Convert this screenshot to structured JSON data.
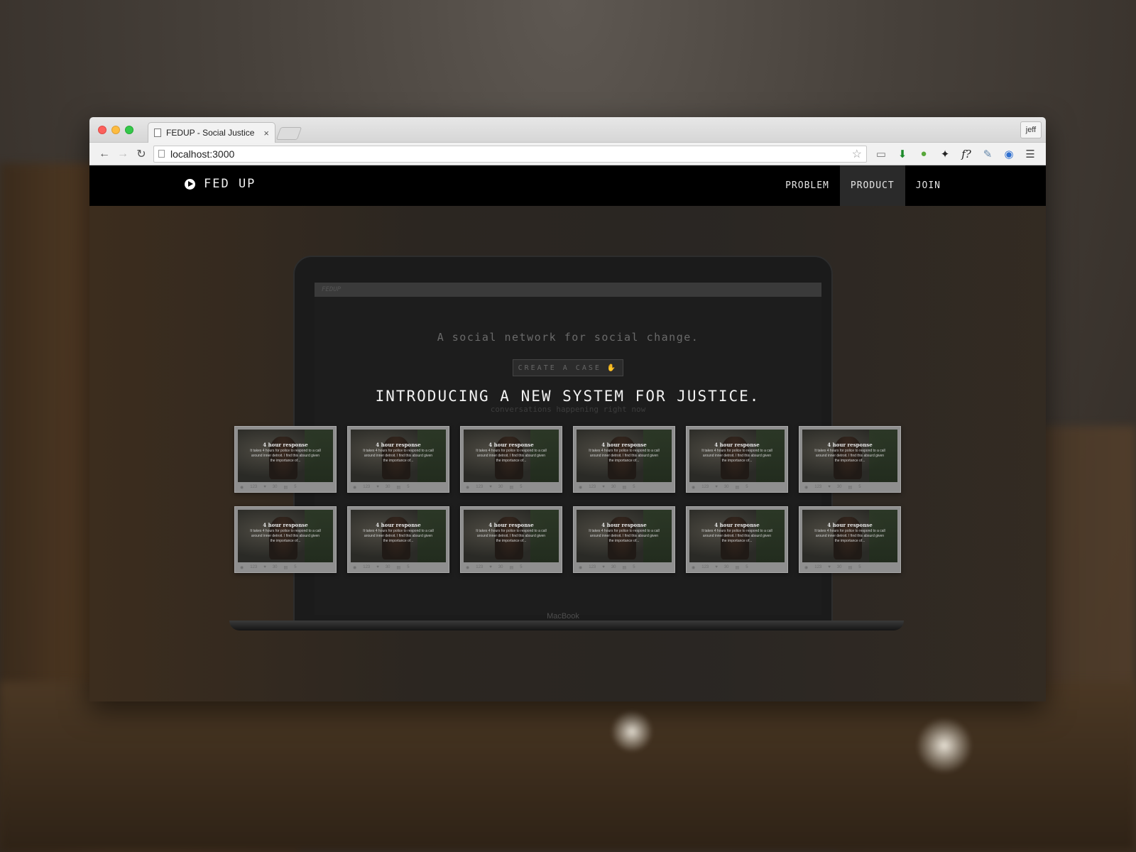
{
  "browser": {
    "tab_title": "FEDUP - Social Justice",
    "tab_close": "×",
    "profile_name": "jeff",
    "url": "localhost:3000",
    "nav_icons": [
      "back-arrow-icon",
      "forward-arrow-icon",
      "reload-icon"
    ],
    "extensions": [
      "cast-icon",
      "download-icon",
      "evernote-icon",
      "bird-icon",
      "function-icon",
      "eyedropper-icon",
      "eye-icon",
      "hamburger-menu-icon"
    ]
  },
  "site": {
    "brand": "FED UP",
    "menu": [
      {
        "label": "PROBLEM",
        "active": false
      },
      {
        "label": "PRODUCT",
        "active": true
      },
      {
        "label": "JOIN",
        "active": false
      }
    ],
    "headline": "INTRODUCING A NEW SYSTEM FOR JUSTICE.",
    "laptop": {
      "mini_logo": "FEDUP",
      "tagline": "A social network for social change.",
      "button": "CREATE A CASE",
      "subtext": "conversations happening right now",
      "device_label": "MacBook"
    },
    "card": {
      "title": "4 hour response",
      "body": "It takes 4 hours for police to respond to a call around inner detroit. I find this absurd given the importance of...",
      "views": "123",
      "likes": "30",
      "comments": "5"
    }
  }
}
